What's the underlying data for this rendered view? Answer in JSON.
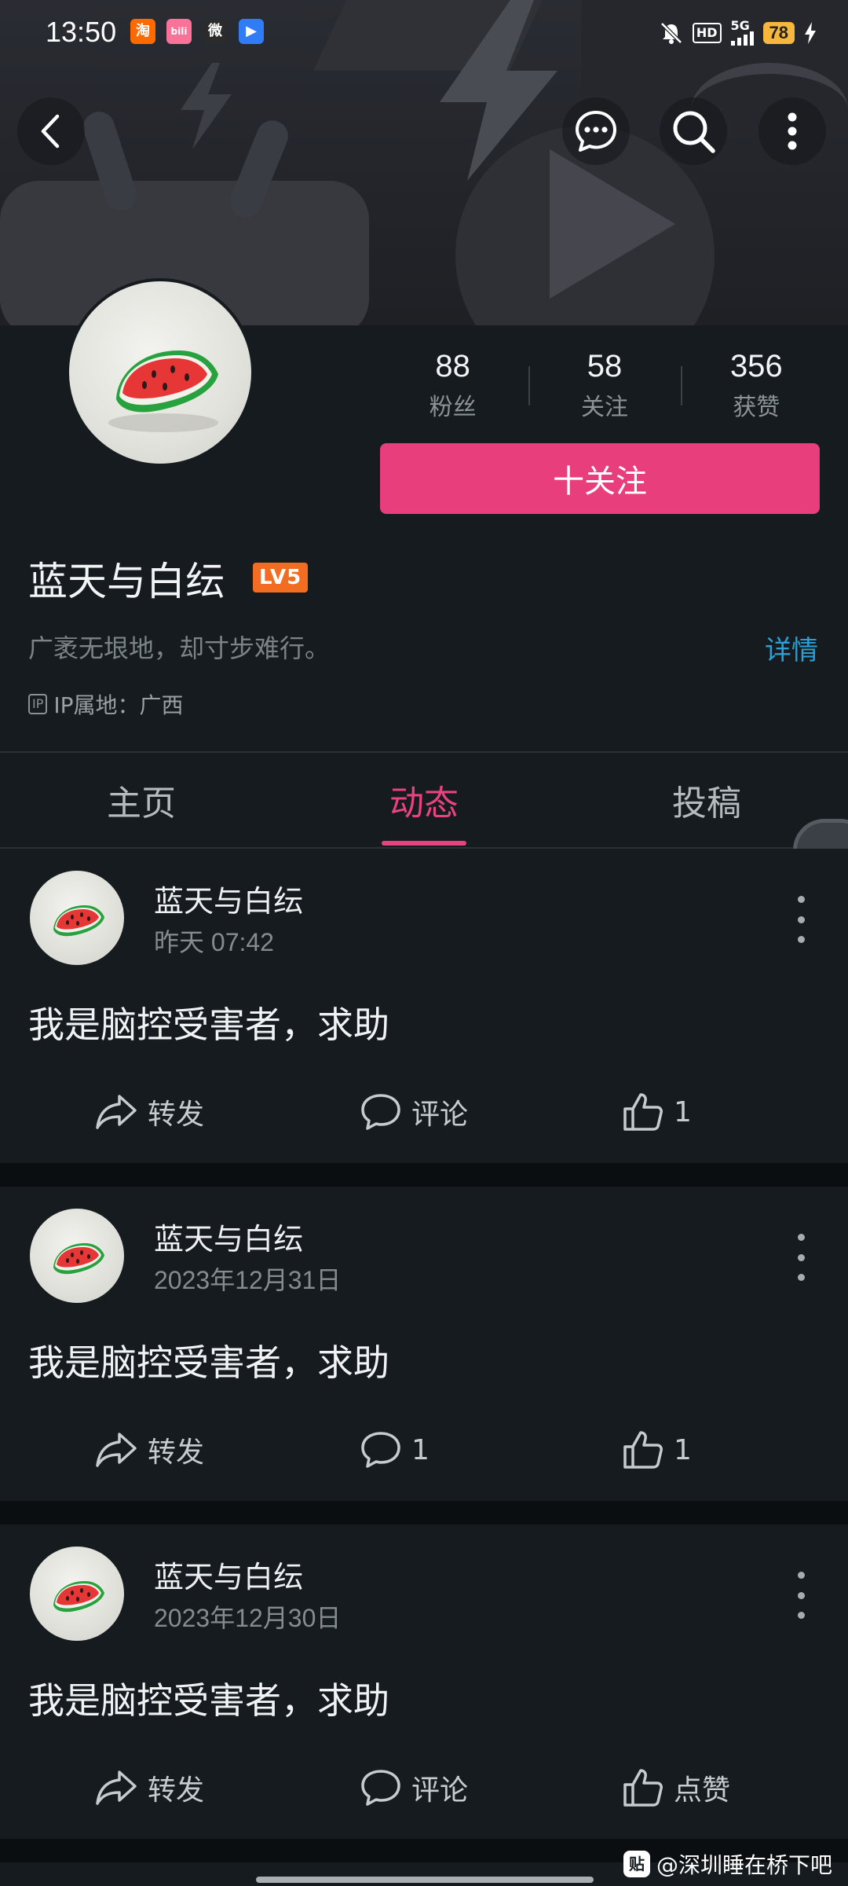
{
  "status_bar": {
    "time": "13:50",
    "battery": "78",
    "network": "5G",
    "hd_label": "HD",
    "apps": [
      {
        "label": "淘",
        "color": "#ff6a00"
      },
      {
        "label": "bili",
        "color": "#fb7299"
      },
      {
        "label": "微",
        "color": "#2b2b2b"
      },
      {
        "label": "▶",
        "color": "#2f7cf6"
      }
    ]
  },
  "profile": {
    "stats": [
      {
        "value": "88",
        "label": "粉丝"
      },
      {
        "value": "58",
        "label": "关注"
      },
      {
        "value": "356",
        "label": "获赞"
      }
    ],
    "follow_label": "十关注",
    "name": "蓝天与白纭",
    "level": "LV5",
    "bio": "广袤无垠地，却寸步难行。",
    "detail_link": "详情",
    "ip_badge": "IP",
    "ip_location": "IP属地：广西"
  },
  "tabs": [
    {
      "label": "主页",
      "active": false
    },
    {
      "label": "动态",
      "active": true
    },
    {
      "label": "投稿",
      "active": false
    }
  ],
  "posts": [
    {
      "author": "蓝天与白纭",
      "time": "昨天 07:42",
      "text": "我是脑控受害者，求助",
      "share": "转发",
      "comment": "评论",
      "like": "1"
    },
    {
      "author": "蓝天与白纭",
      "time": "2023年12月31日",
      "text": "我是脑控受害者，求助",
      "share": "转发",
      "comment": "1",
      "like": "1"
    },
    {
      "author": "蓝天与白纭",
      "time": "2023年12月30日",
      "text": "我是脑控受害者，求助",
      "share": "转发",
      "comment": "评论",
      "like": "点赞"
    }
  ],
  "watermark": {
    "icon": "贴",
    "text": "@深圳睡在桥下吧"
  },
  "colors": {
    "accent": "#e83e7b",
    "link": "#2aa0d6",
    "background": "#151b1e"
  }
}
